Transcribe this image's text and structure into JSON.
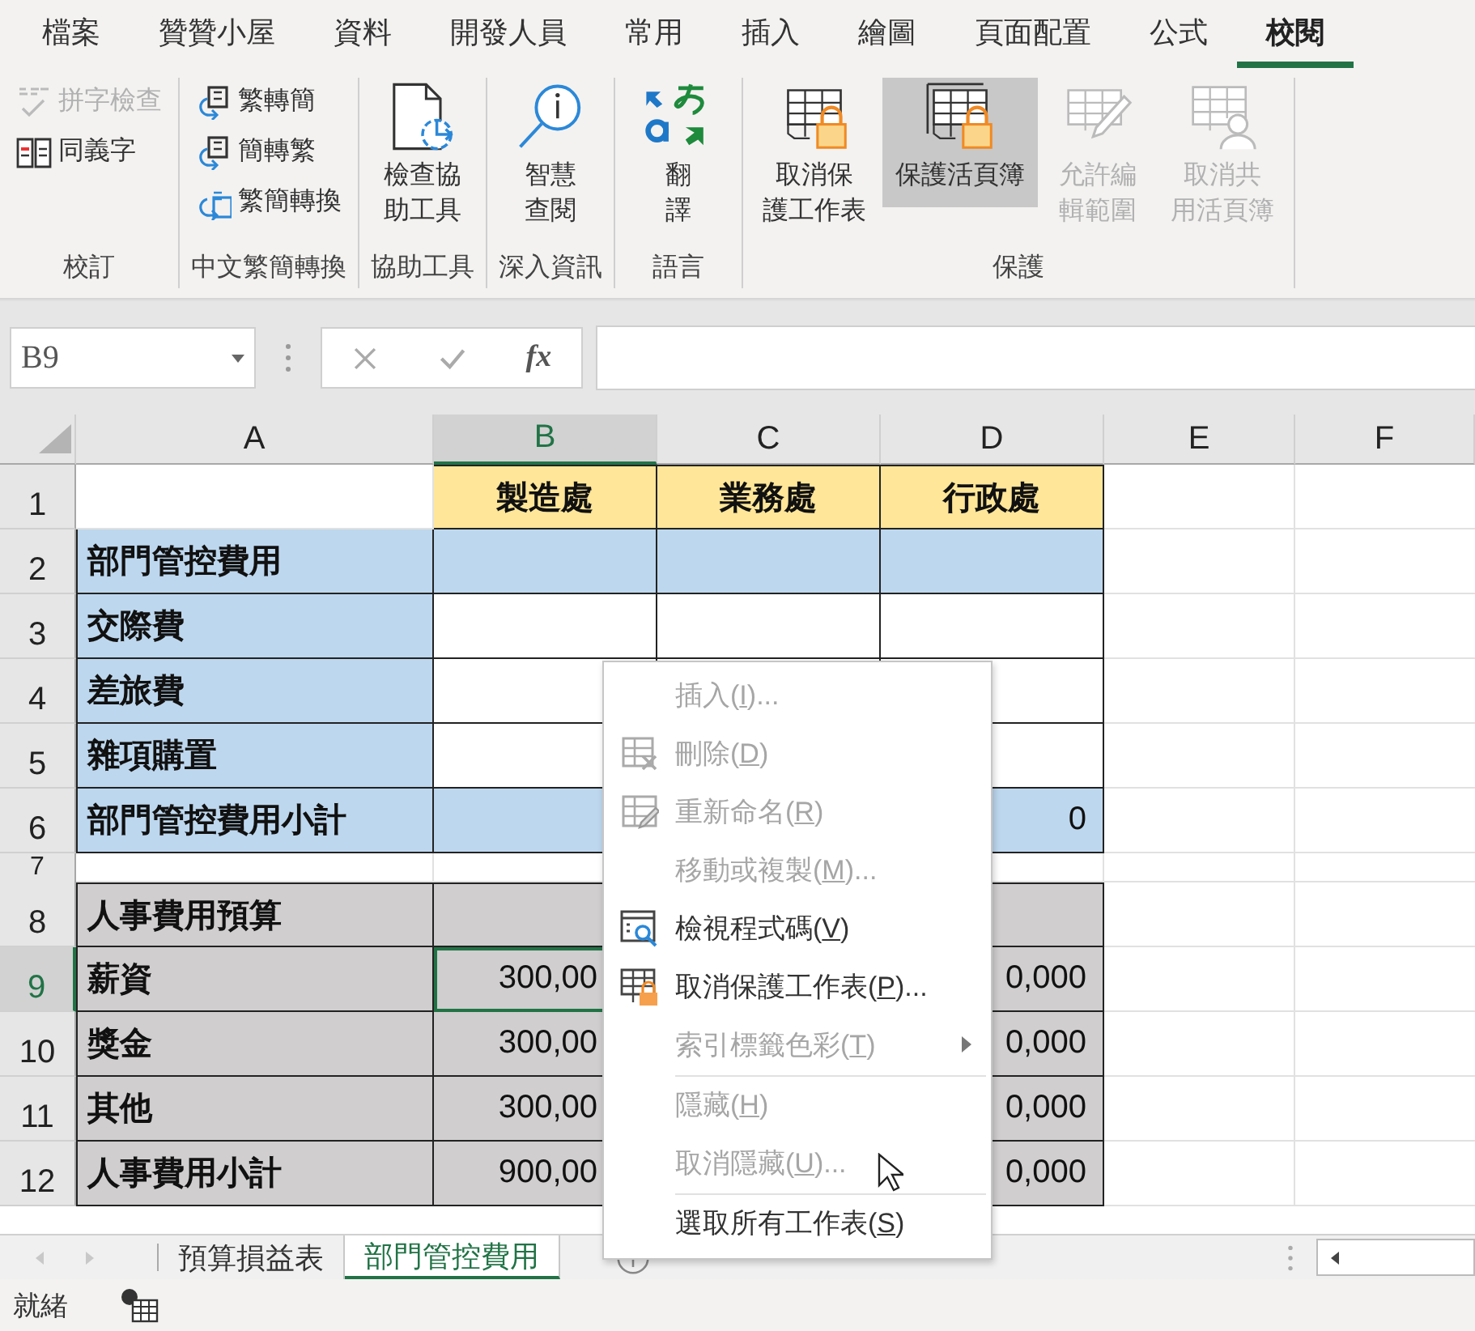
{
  "ribbon_tabs": [
    {
      "label": "檔案",
      "selected": false
    },
    {
      "label": "贊贊小屋",
      "selected": false
    },
    {
      "label": "資料",
      "selected": false
    },
    {
      "label": "開發人員",
      "selected": false
    },
    {
      "label": "常用",
      "selected": false
    },
    {
      "label": "插入",
      "selected": false
    },
    {
      "label": "繪圖",
      "selected": false
    },
    {
      "label": "頁面配置",
      "selected": false
    },
    {
      "label": "公式",
      "selected": false
    },
    {
      "label": "校閱",
      "selected": true
    }
  ],
  "ribbon_groups": [
    {
      "label": "校訂",
      "items": [
        {
          "kind": "small",
          "lines": [
            "拼字檢查"
          ],
          "disabled": true,
          "pressed": false
        },
        {
          "kind": "small",
          "lines": [
            "同義字"
          ],
          "disabled": false,
          "pressed": false
        }
      ]
    },
    {
      "label": "中文繁簡轉換",
      "items": [
        {
          "kind": "small",
          "lines": [
            "繁轉簡"
          ],
          "disabled": false,
          "pressed": false
        },
        {
          "kind": "small",
          "lines": [
            "簡轉繁"
          ],
          "disabled": false,
          "pressed": false
        },
        {
          "kind": "small",
          "lines": [
            "繁簡轉換"
          ],
          "disabled": false,
          "pressed": false
        }
      ]
    },
    {
      "label": "協助工具",
      "items": [
        {
          "kind": "large",
          "lines": [
            "檢查協",
            "助工具"
          ],
          "disabled": false,
          "pressed": false
        }
      ]
    },
    {
      "label": "深入資訊",
      "items": [
        {
          "kind": "large",
          "lines": [
            "智慧",
            "查閱"
          ],
          "disabled": false,
          "pressed": false
        }
      ]
    },
    {
      "label": "語言",
      "items": [
        {
          "kind": "large",
          "lines": [
            "翻",
            "譯"
          ],
          "disabled": false,
          "pressed": false
        }
      ]
    },
    {
      "label": "保護",
      "items": [
        {
          "kind": "large",
          "lines": [
            "取消保",
            "護工作表"
          ],
          "disabled": false,
          "pressed": false
        },
        {
          "kind": "large",
          "lines": [
            "保護活頁簿"
          ],
          "disabled": false,
          "pressed": true
        },
        {
          "kind": "large",
          "lines": [
            "允許編",
            "輯範圍"
          ],
          "disabled": true,
          "pressed": false
        },
        {
          "kind": "large",
          "lines": [
            "取消共",
            "用活頁簿"
          ],
          "disabled": true,
          "pressed": false
        }
      ]
    }
  ],
  "formula_bar": {
    "name_box": "B9",
    "function_label": "fx"
  },
  "columns": [
    {
      "label": "A",
      "selected": false
    },
    {
      "label": "B",
      "selected": true
    },
    {
      "label": "C",
      "selected": false
    },
    {
      "label": "D",
      "selected": false
    },
    {
      "label": "E",
      "selected": false
    },
    {
      "label": "F",
      "selected": false
    }
  ],
  "rows": [
    {
      "number": "1",
      "kind": "header",
      "selected": false,
      "b": "製造處",
      "c": "業務處",
      "d": "行政處"
    },
    {
      "number": "2",
      "kind": "group",
      "selected": false,
      "a": "部門管控費用"
    },
    {
      "number": "3",
      "kind": "item",
      "selected": false,
      "a": "交際費"
    },
    {
      "number": "4",
      "kind": "item",
      "selected": false,
      "a": "差旅費"
    },
    {
      "number": "5",
      "kind": "item",
      "selected": false,
      "a": "雜項購置"
    },
    {
      "number": "6",
      "kind": "group",
      "selected": false,
      "a": "部門管控費用小計",
      "d": "0"
    },
    {
      "number": "7",
      "kind": "spacer",
      "selected": false
    },
    {
      "number": "8",
      "kind": "gray",
      "selected": false,
      "a": "人事費用預算"
    },
    {
      "number": "9",
      "kind": "gray",
      "selected": true,
      "a": "薪資",
      "b": "300,00",
      "d": "0,000"
    },
    {
      "number": "10",
      "kind": "gray",
      "selected": false,
      "a": "獎金",
      "b": "300,00",
      "d": "0,000"
    },
    {
      "number": "11",
      "kind": "gray",
      "selected": false,
      "a": "其他",
      "b": "300,00",
      "d": "0,000"
    },
    {
      "number": "12",
      "kind": "gray",
      "selected": false,
      "a": "人事費用小計",
      "b": "900,00",
      "d": "0,000"
    }
  ],
  "context_menu": [
    {
      "text": "插入(",
      "key": "I",
      "after": ")...",
      "disabled": true,
      "separator_before": false,
      "submenu": false
    },
    {
      "text": "刪除(",
      "key": "D",
      "after": ")",
      "disabled": true,
      "separator_before": false,
      "submenu": false
    },
    {
      "text": "重新命名(",
      "key": "R",
      "after": ")",
      "disabled": true,
      "separator_before": false,
      "submenu": false
    },
    {
      "text": "移動或複製(",
      "key": "M",
      "after": ")...",
      "disabled": true,
      "separator_before": false,
      "submenu": false
    },
    {
      "text": "檢視程式碼(",
      "key": "V",
      "after": ")",
      "disabled": false,
      "separator_before": false,
      "submenu": false
    },
    {
      "text": "取消保護工作表(",
      "key": "P",
      "after": ")...",
      "disabled": false,
      "separator_before": false,
      "submenu": false
    },
    {
      "text": "索引標籤色彩(",
      "key": "T",
      "after": ")",
      "disabled": true,
      "separator_before": false,
      "submenu": true
    },
    {
      "text": "隱藏(",
      "key": "H",
      "after": ")",
      "disabled": true,
      "separator_before": true,
      "submenu": false
    },
    {
      "text": "取消隱藏(",
      "key": "U",
      "after": ")...",
      "disabled": true,
      "separator_before": false,
      "submenu": false
    },
    {
      "text": "選取所有工作表(",
      "key": "S",
      "after": ")",
      "disabled": false,
      "separator_before": true,
      "submenu": false
    }
  ],
  "sheet_tabs": [
    {
      "label": "預算損益表",
      "selected": false
    },
    {
      "label": "部門管控費用",
      "selected": true
    }
  ],
  "status_bar": {
    "text": "就緒"
  }
}
